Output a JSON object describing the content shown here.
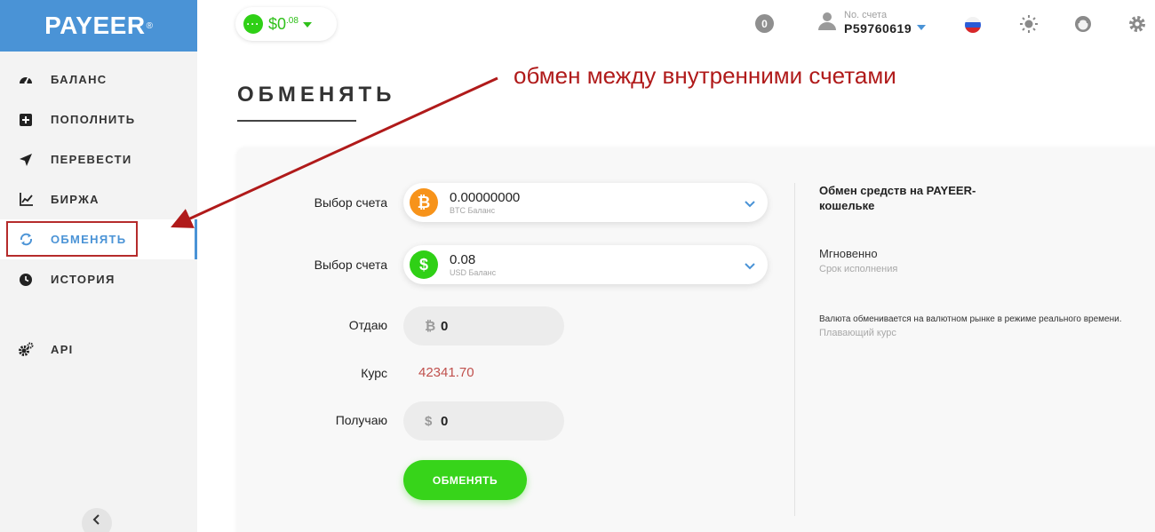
{
  "app": {
    "logo": "PAYEER",
    "logo_reg": "®"
  },
  "colors": {
    "brand_blue": "#4a93d6",
    "green": "#37d41a",
    "annotation_red": "#b01a1a",
    "rate_red": "#c0504d"
  },
  "sidebar": {
    "items": [
      {
        "label": "БАЛАНС",
        "icon": "gauge-icon"
      },
      {
        "label": "ПОПОЛНИТЬ",
        "icon": "plus-square-icon"
      },
      {
        "label": "ПЕРЕВЕСТИ",
        "icon": "send-icon"
      },
      {
        "label": "БИРЖА",
        "icon": "chart-icon"
      },
      {
        "label": "ОБМЕНЯТЬ",
        "icon": "exchange-icon",
        "active": true
      },
      {
        "label": "ИСТОРИЯ",
        "icon": "clock-icon"
      },
      {
        "label": "API",
        "icon": "gears-icon"
      }
    ],
    "collapse_icon": "chevron-left-icon"
  },
  "header": {
    "balance_dots": "···",
    "balance_main": "$0",
    "balance_cents": ".08",
    "notifications": "0",
    "account_label": "No. счета",
    "account_number": "P59760619",
    "icons": [
      "russia-flag-icon",
      "sun-icon",
      "support-icon",
      "gear-icon"
    ]
  },
  "annotation": {
    "text": "обмен между внутренними счетами"
  },
  "page": {
    "title": "ОБМЕНЯТЬ"
  },
  "form": {
    "from_label": "Выбор счета",
    "from_value": "0.00000000",
    "from_sub": "BTC Баланс",
    "from_symbol": "₿",
    "to_label": "Выбор счета",
    "to_value": "0.08",
    "to_sub": "USD Баланс",
    "to_symbol": "$",
    "give_label": "Отдаю",
    "give_symbol": "₿",
    "give_value": "0",
    "rate_label": "Курс",
    "rate_value": "42341.70",
    "receive_label": "Получаю",
    "receive_symbol": "$",
    "receive_value": "0",
    "submit_label": "ОБМЕНЯТЬ"
  },
  "info": {
    "title": "Обмен средств на PAYEER-кошельке",
    "speed": "Мгновенно",
    "speed_sub": "Срок исполнения",
    "rate_desc": "Валюта обменивается на валютном рынке в режиме реального времени.",
    "rate_sub": "Плавающий курс"
  }
}
